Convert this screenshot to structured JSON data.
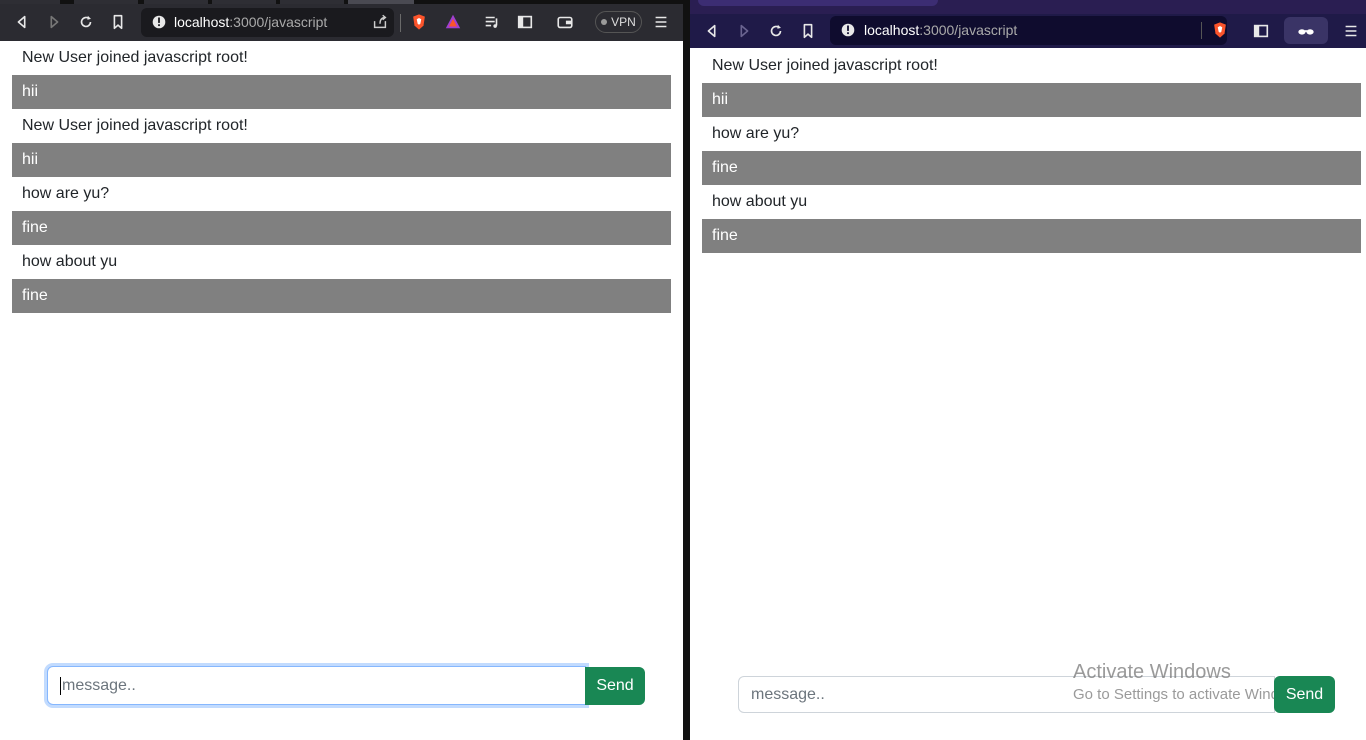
{
  "left_browser": {
    "url_host": "localhost",
    "url_path": ":3000/javascript",
    "vpn_label": "VPN",
    "icons": [
      "back-icon",
      "forward-icon",
      "reload-icon",
      "bookmark-icon",
      "info-icon",
      "share-icon",
      "brave-shields-icon",
      "brave-rewards-icon",
      "playlist-icon",
      "sidebar-icon",
      "wallet-icon",
      "menu-icon"
    ]
  },
  "right_browser": {
    "url_host": "localhost",
    "url_path": ":3000/javascript",
    "icons": [
      "back-icon",
      "forward-icon",
      "reload-icon",
      "bookmark-icon",
      "info-icon",
      "brave-shields-icon",
      "sidebar-icon",
      "private-glasses-icon",
      "menu-icon"
    ]
  },
  "left_chat": {
    "messages": [
      {
        "text": "New User joined javascript root!",
        "style": "plain"
      },
      {
        "text": "hii",
        "style": "highlight"
      },
      {
        "text": "New User joined javascript root!",
        "style": "plain"
      },
      {
        "text": "hii",
        "style": "highlight"
      },
      {
        "text": "how are yu?",
        "style": "plain"
      },
      {
        "text": "fine",
        "style": "highlight"
      },
      {
        "text": "how about yu",
        "style": "plain"
      },
      {
        "text": "fine",
        "style": "highlight"
      }
    ],
    "input_placeholder": "message..",
    "send_label": "Send"
  },
  "right_chat": {
    "messages": [
      {
        "text": "New User joined javascript root!",
        "style": "plain"
      },
      {
        "text": "hii",
        "style": "highlight"
      },
      {
        "text": "how are yu?",
        "style": "plain"
      },
      {
        "text": "fine",
        "style": "highlight"
      },
      {
        "text": "how about yu",
        "style": "plain"
      },
      {
        "text": "fine",
        "style": "highlight"
      }
    ],
    "input_placeholder": "message..",
    "send_label": "Send"
  },
  "watermark": {
    "line1": "Activate Windows",
    "line2": "Go to Settings to activate Windows."
  },
  "colors": {
    "highlight_bg": "#808080",
    "send_button": "#198754",
    "left_toolbar": "#2b2b31",
    "right_toolbar": "#1f1a48"
  }
}
